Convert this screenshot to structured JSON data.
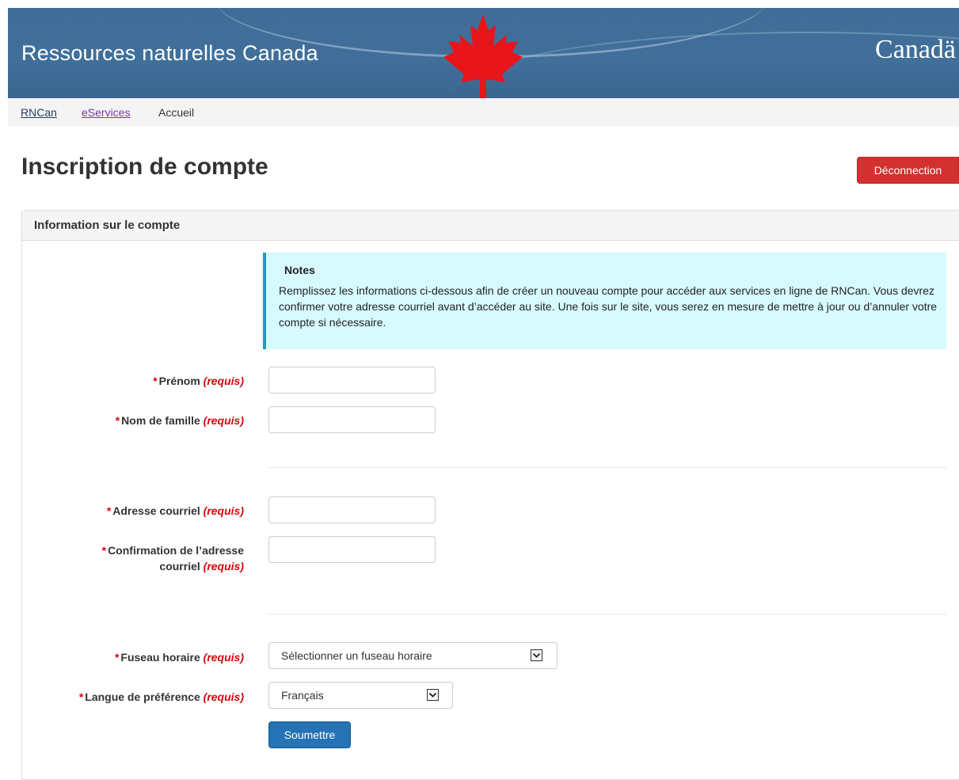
{
  "header": {
    "department": "Ressources naturelles Canada",
    "wordmark": "Canadä"
  },
  "breadcrumb": {
    "items": [
      "RNCan",
      "eServices",
      "Accueil"
    ]
  },
  "page": {
    "title": "Inscription de compte",
    "logout_label": "Déconnection"
  },
  "panel": {
    "title": "Information sur le compte"
  },
  "notes": {
    "title": "Notes",
    "body": "Remplissez les informations ci-dessous afin de créer un nouveau compte pour accéder aux services en ligne de RNCan. Vous devrez confirmer votre adresse courriel avant d’accéder au site. Une fois sur le site, vous serez en mesure de mettre à jour ou d’annuler votre compte si nécessaire."
  },
  "form": {
    "required_marker": "*",
    "required_text": "(requis)",
    "first_name_label": "Prénom",
    "first_name_value": "",
    "last_name_label": "Nom de famille",
    "last_name_value": "",
    "email_label": "Adresse courriel",
    "email_value": "",
    "email_confirm_label_1": "Confirmation de l’adresse",
    "email_confirm_label_2": "courriel",
    "email_confirm_value": "",
    "timezone_label": "Fuseau horaire",
    "timezone_value": "Sélectionner un fuseau horaire",
    "language_label": "Langue de préférence",
    "language_value": "Français",
    "submit_label": "Soumettre"
  },
  "colors": {
    "banner": "#3f6d97",
    "danger": "#d3312f",
    "primary": "#2572b4",
    "required": "#d3080c",
    "notes_bg": "#d7faff"
  }
}
